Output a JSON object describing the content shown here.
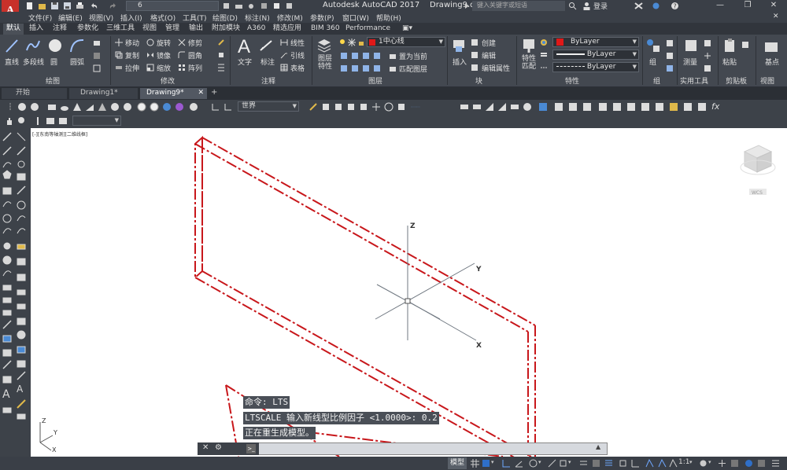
{
  "titlebar": {
    "app_name": "Autodesk AutoCAD 2017",
    "file_name": "Drawing9.dwg",
    "workspace_value": "6",
    "search_placeholder": "键入关键字或短语",
    "login_label": "登录",
    "logo_letter": "A"
  },
  "menubar": {
    "items": [
      "文件(F)",
      "编辑(E)",
      "视图(V)",
      "插入(I)",
      "格式(O)",
      "工具(T)",
      "绘图(D)",
      "标注(N)",
      "修改(M)",
      "参数(P)",
      "窗口(W)",
      "帮助(H)"
    ]
  },
  "ribbon_tabs": {
    "items": [
      "默认",
      "插入",
      "注释",
      "参数化",
      "三维工具",
      "视图",
      "管理",
      "输出",
      "附加模块",
      "A360",
      "精选应用",
      "BIM 360",
      "Performance"
    ],
    "active": "默认"
  },
  "ribbon": {
    "draw": {
      "line": "直线",
      "polyline": "多段线",
      "circle": "圆",
      "arc": "圆弧",
      "panel": "绘图"
    },
    "modify": {
      "move": "移动",
      "rotate": "旋转",
      "trim": "修剪",
      "copy": "复制",
      "mirror": "镜像",
      "fillet": "圆角",
      "stretch": "拉伸",
      "scale": "缩放",
      "array": "阵列",
      "panel": "修改"
    },
    "annotation": {
      "text": "文字",
      "dimension": "标注",
      "linear": "线性",
      "leader": "引线",
      "table": "表格",
      "panel": "注释"
    },
    "layers": {
      "layer_properties": "图层\n特性",
      "current_layer": "1中心线",
      "make_current": "置为当前",
      "match_layer": "匹配图层",
      "panel": "图层"
    },
    "block": {
      "insert": "插入",
      "create": "创建",
      "edit": "编辑",
      "edit_attributes": "编辑属性",
      "panel": "块"
    },
    "properties": {
      "match": "特性\n匹配",
      "color": "ByLayer",
      "lineweight": "ByLayer",
      "linetype": "ByLayer",
      "panel": "特性"
    },
    "groups": {
      "group": "组",
      "panel": "组"
    },
    "utilities": {
      "measure": "测量",
      "panel": "实用工具"
    },
    "clipboard": {
      "paste": "粘贴",
      "panel": "剪贴板"
    },
    "view": {
      "base": "基点",
      "panel": "视图"
    },
    "colors": {
      "red_swatch": "#e01818"
    }
  },
  "filetabs": {
    "items": [
      "开始",
      "Drawing1*",
      "Drawing9*"
    ],
    "active": "Drawing9*",
    "add_label": "+"
  },
  "toolbar1": {
    "visual_style": "世界"
  },
  "canvas": {
    "view_label": "[-][东南等轴测][二维线框]",
    "axis_labels": {
      "z": "Z",
      "y": "Y",
      "x": "X"
    },
    "ucs_labels": {
      "z": "Z",
      "y": "Y",
      "x": "X"
    },
    "viewcube_label": "WCS"
  },
  "command": {
    "history": [
      "命令: LTS",
      "LTSCALE 输入新线型比例因子 <1.0000>: 0.2",
      "正在重生成模型。"
    ],
    "input_placeholder": ""
  },
  "statusbar": {
    "model_label": "模型",
    "scale_label": "1:1"
  }
}
